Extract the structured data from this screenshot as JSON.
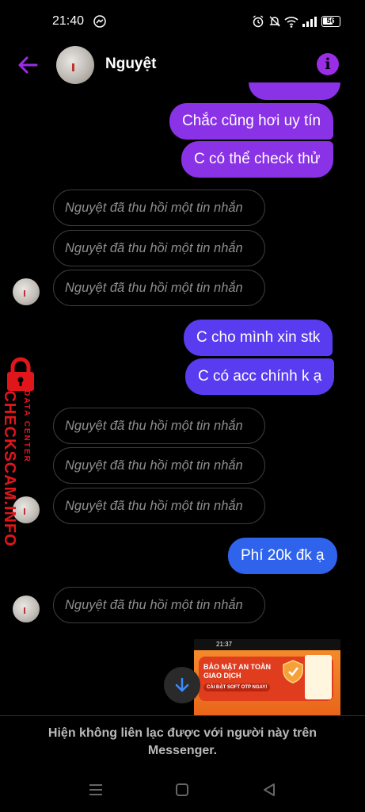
{
  "status_bar": {
    "time": "21:40",
    "battery": "56"
  },
  "header": {
    "contact_name": "Nguyệt",
    "info_icon": "i"
  },
  "messages": {
    "out1": "Chắc cũng hơi uy tín",
    "out2": "C có thể check thử",
    "out3": "C cho mình xin stk",
    "out4": "C có acc chính k ạ",
    "out5": "Phí 20k đk ạ",
    "recalled": "Nguyệt đã thu hồi một tin nhắn"
  },
  "watermark": {
    "brand": "CHECKSCAM.INFO",
    "tagline": "DATA CENTER"
  },
  "attachment": {
    "time": "21:37",
    "banner_line1": "BẢO MẬT AN TOÀN",
    "banner_line2": "GIAO DỊCH",
    "banner_cta": "CÀI ĐẶT SOFT OTP NGAY!"
  },
  "footer": {
    "notice": "Hiện không liên lạc được với người này trên Messenger."
  },
  "colors": {
    "accent": "#9a2ee6",
    "bubble_purple": "#8a32e6",
    "bubble_indigo": "#5a3cf0",
    "bubble_blue": "#2f63ec"
  }
}
